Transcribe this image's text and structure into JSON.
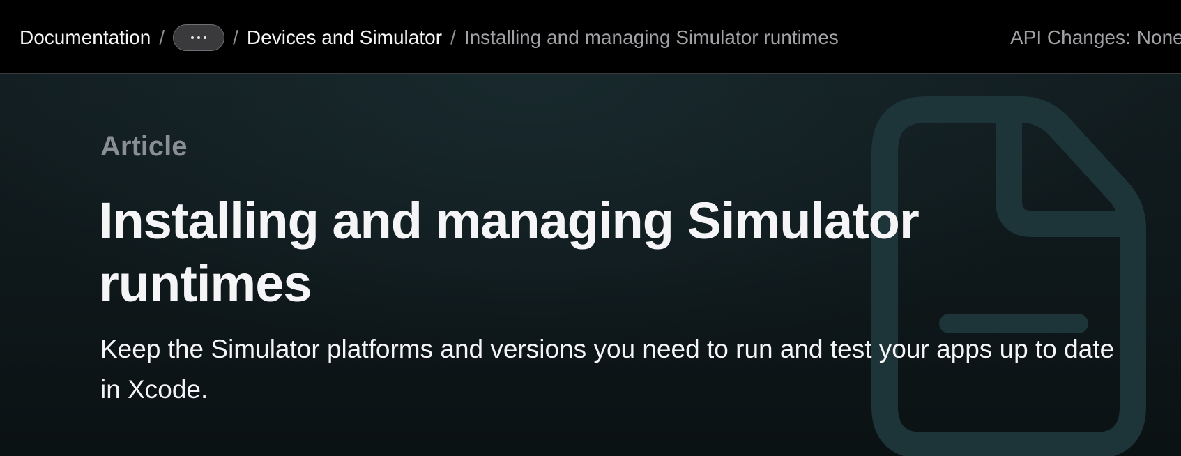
{
  "breadcrumb": {
    "items": [
      {
        "label": "Documentation"
      },
      {
        "label": "Devices and Simulator"
      },
      {
        "label": "Installing and managing Simulator runtimes"
      }
    ],
    "separator": "/",
    "more_icon": "ellipsis-icon"
  },
  "api_changes": {
    "label": "API Changes:",
    "value": "None"
  },
  "article": {
    "eyebrow": "Article",
    "title": "Installing and managing Simulator runtimes",
    "abstract": "Keep the Simulator platforms and versions you need to run and test your apps up to date in Xcode.",
    "icon": "document-icon"
  },
  "colors": {
    "nav_background": "#000000",
    "hero_background": "#121d20",
    "text_primary": "#f5f5f7",
    "text_secondary": "#a1a1a6",
    "icon_color": "#1d3438"
  }
}
